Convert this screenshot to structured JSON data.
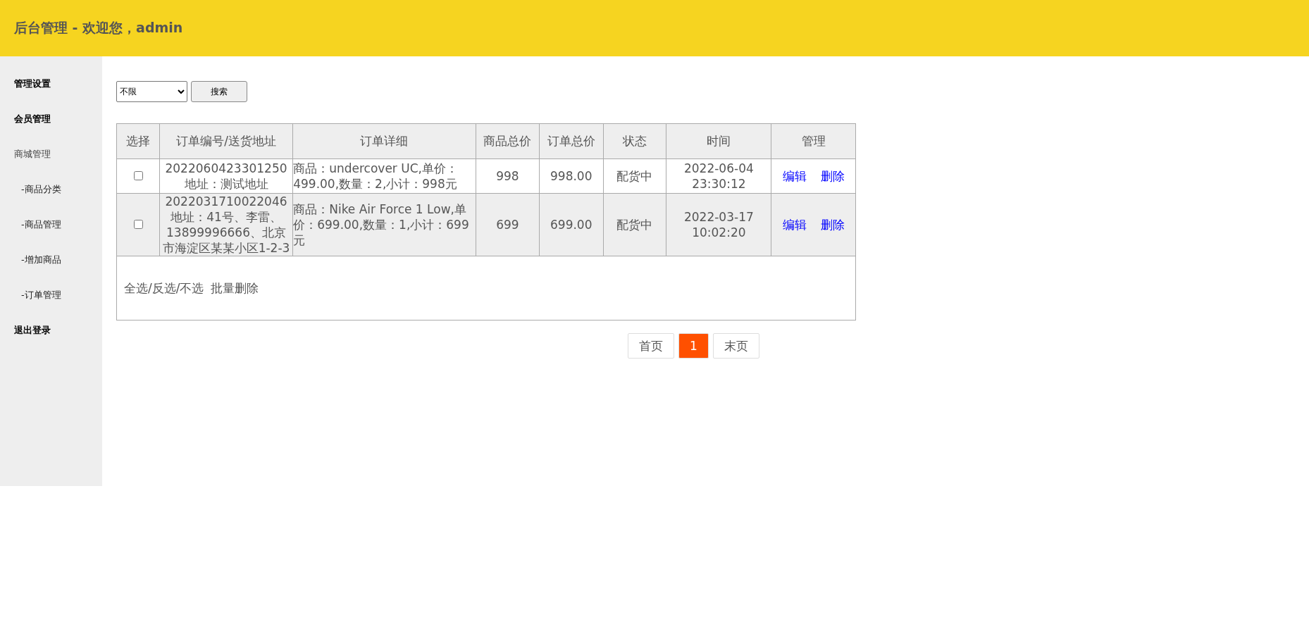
{
  "header": {
    "title": "后台管理 - 欢迎您，admin"
  },
  "sidebar": {
    "items": [
      {
        "label": "管理设置",
        "kind": "section"
      },
      {
        "label": "会员管理",
        "kind": "section"
      },
      {
        "label": "商城管理",
        "kind": "group",
        "children": [
          {
            "label": "-商品分类"
          },
          {
            "label": "-商品管理"
          },
          {
            "label": "-增加商品"
          },
          {
            "label": "-订单管理"
          }
        ]
      },
      {
        "label": "退出登录",
        "kind": "section"
      }
    ]
  },
  "filter": {
    "select_value": "不限",
    "button": "搜索"
  },
  "table": {
    "columns": [
      "选择",
      "订单编号/送货地址",
      "订单详细",
      "商品总价",
      "订单总价",
      "状态",
      "时间",
      "管理"
    ],
    "rows": [
      {
        "checked": false,
        "order_no": "2022060423301250",
        "address": "地址：测试地址",
        "detail": "商品：undercover UC,单价：499.00,数量：2,小计：998元",
        "goods_total": "998",
        "order_total": "998.00",
        "status": "配货中",
        "date": "2022-06-04",
        "time": "23:30:12",
        "actions": [
          "编辑",
          "删除"
        ]
      },
      {
        "checked": false,
        "order_no": "2022031710022046",
        "address": "地址：41号、李雷、13899996666、北京市海淀区某某小区1-2-3",
        "detail": "商品：Nike Air Force 1 Low,单价：699.00,数量：1,小计：699元",
        "goods_total": "699",
        "order_total": "699.00",
        "status": "配货中",
        "date": "2022-03-17",
        "time": "10:02:20",
        "actions": [
          "编辑",
          "删除"
        ]
      }
    ],
    "footer": {
      "select_links": "全选/反选/不选",
      "batch_delete": "批量删除"
    }
  },
  "pagination": {
    "first": "首页",
    "pages": [
      {
        "label": "1",
        "selected": true
      }
    ],
    "last": "末页"
  }
}
